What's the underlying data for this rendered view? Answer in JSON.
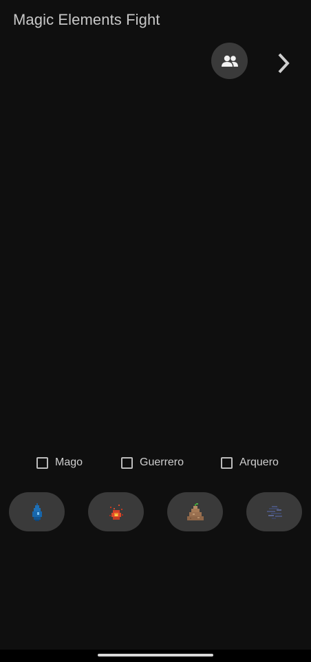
{
  "app": {
    "title": "Magic Elements Fight"
  },
  "header": {
    "players_icon": "people-icon",
    "next_icon": "chevron-right-icon"
  },
  "classes": [
    {
      "label": "Mago",
      "checked": false
    },
    {
      "label": "Guerrero",
      "checked": false
    },
    {
      "label": "Arquero",
      "checked": false
    }
  ],
  "elements": [
    {
      "name": "water",
      "icon": "water-drop-icon",
      "color": "#1e6fb5"
    },
    {
      "name": "fire",
      "icon": "fire-icon",
      "color": "#e0492a"
    },
    {
      "name": "earth",
      "icon": "earth-mound-icon",
      "color": "#a57a56"
    },
    {
      "name": "air",
      "icon": "wind-icon",
      "color": "#4b5478"
    }
  ]
}
